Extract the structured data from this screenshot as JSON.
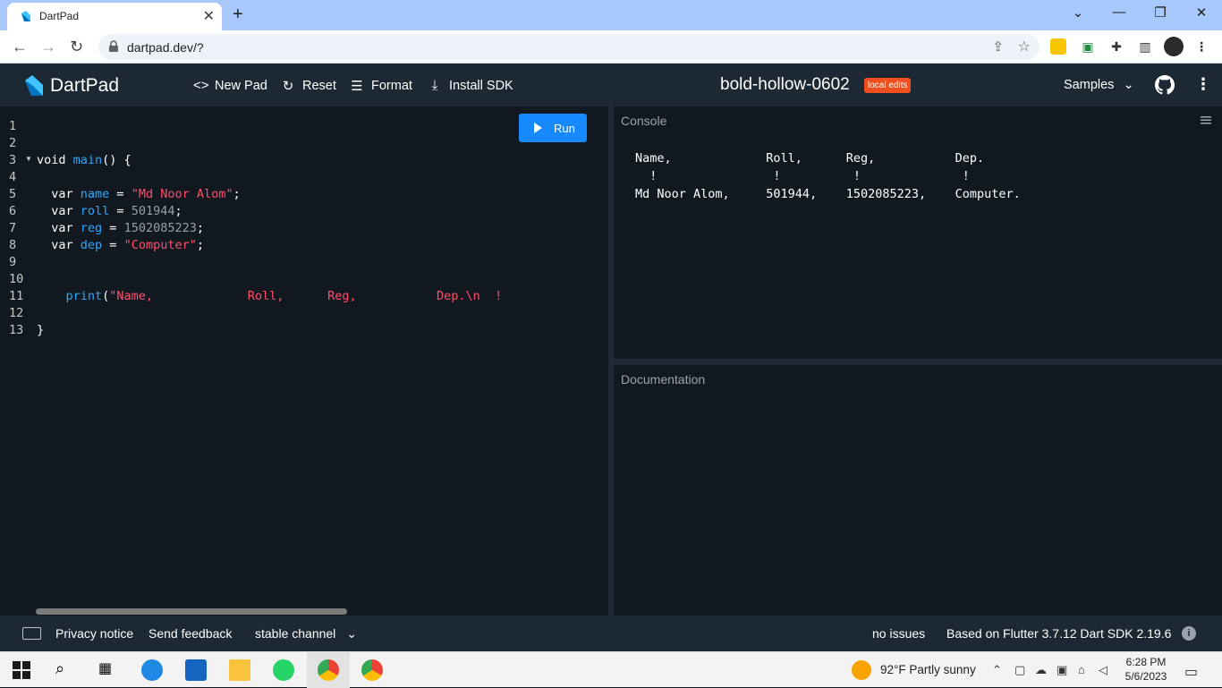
{
  "browser": {
    "tab_title": "DartPad",
    "url": "dartpad.dev/?"
  },
  "header": {
    "brand": "DartPad",
    "new_pad": "New Pad",
    "reset": "Reset",
    "format": "Format",
    "install_sdk": "Install SDK",
    "pad_title": "bold-hollow-0602",
    "badge": "local edits",
    "samples": "Samples"
  },
  "editor": {
    "run_label": "Run",
    "line_numbers": [
      "1",
      "2",
      "3",
      "4",
      "5",
      "6",
      "7",
      "8",
      "9",
      "10",
      "11",
      "12",
      "13"
    ]
  },
  "console": {
    "title": "Console",
    "line1": "Name,             Roll,      Reg,           Dep.",
    "line2": "  !                !          !              !",
    "line3": "Md Noor Alom,     501944,    1502085223,    Computer."
  },
  "docs": {
    "title": "Documentation"
  },
  "footer": {
    "privacy": "Privacy notice",
    "feedback": "Send feedback",
    "channel": "stable channel",
    "issues": "no issues",
    "sdk": "Based on Flutter 3.7.12 Dart SDK 2.19.6"
  },
  "taskbar": {
    "weather": "92°F  Partly sunny",
    "time": "6:28 PM",
    "date": "5/6/2023"
  },
  "colors": {
    "accent": "#168afd",
    "badge": "#ef4e1f",
    "string": "#ff4f6f",
    "identifier": "#2aa9ff"
  }
}
